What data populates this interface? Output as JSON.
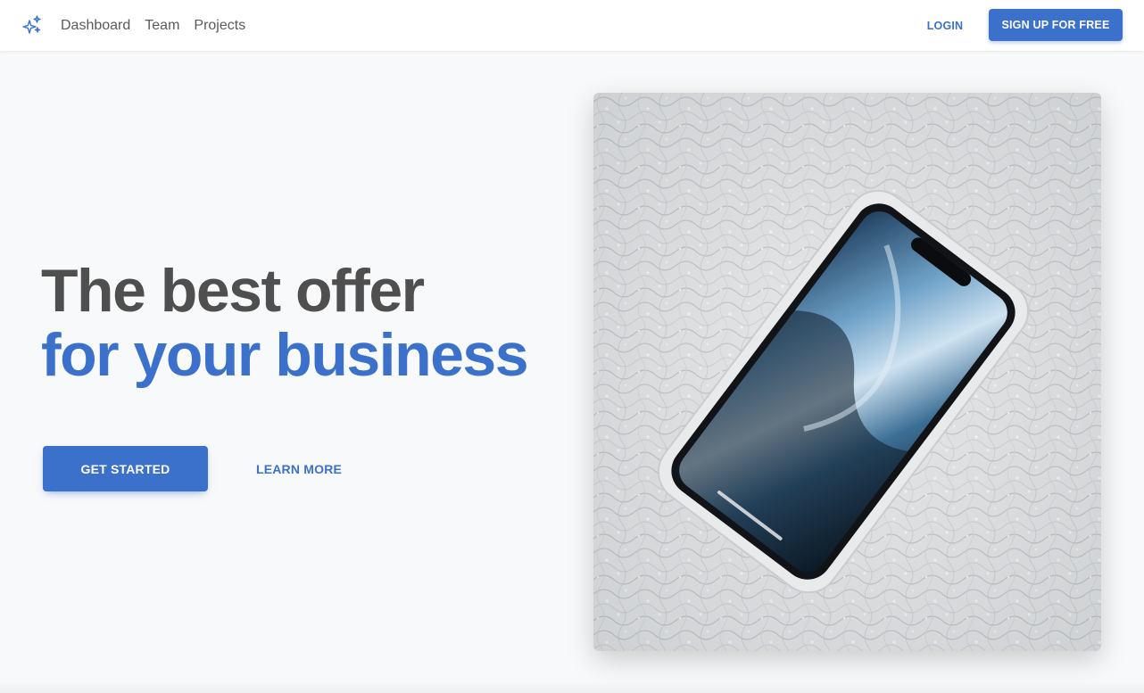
{
  "navbar": {
    "brand_icon": "sparkles-icon",
    "links": [
      {
        "label": "Dashboard"
      },
      {
        "label": "Team"
      },
      {
        "label": "Projects"
      }
    ],
    "login_label": "LOGIN",
    "signup_label": "SIGN UP FOR FREE"
  },
  "hero": {
    "headline_line1": "The best offer",
    "headline_line2": "for your business",
    "primary_cta": "GET STARTED",
    "secondary_cta": "LEARN MORE",
    "image_subject": "smartphone-on-textured-surface"
  },
  "colors": {
    "accent": "#3b71ca",
    "heading": "#4f4f4f",
    "background": "#f8f9fa"
  }
}
